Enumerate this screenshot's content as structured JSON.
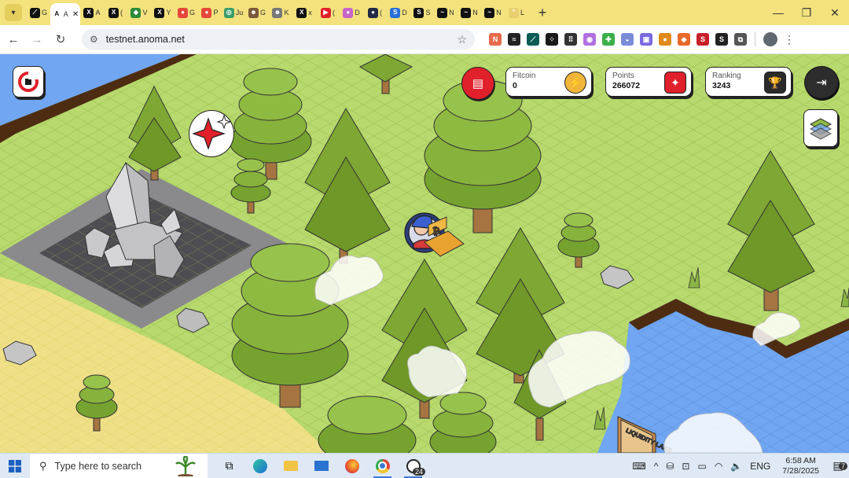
{
  "browser": {
    "tabs": [
      {
        "letter": "G",
        "fav": "#111111",
        "glyph": "⟋"
      },
      {
        "letter": "A",
        "fav": "#ffffff",
        "glyph": "A",
        "active": true
      },
      {
        "letter": "A",
        "fav": "#111111",
        "glyph": "X"
      },
      {
        "letter": "(",
        "fav": "#111111",
        "glyph": "X"
      },
      {
        "letter": "V",
        "fav": "#2c8a3a",
        "glyph": "◆"
      },
      {
        "letter": "Y",
        "fav": "#111111",
        "glyph": "X"
      },
      {
        "letter": "G",
        "fav": "#e4473a",
        "glyph": "●"
      },
      {
        "letter": "P",
        "fav": "#e4473a",
        "glyph": "●"
      },
      {
        "letter": "Ju",
        "fav": "#3a9d6a",
        "glyph": "◎"
      },
      {
        "letter": "G",
        "fav": "#7a5a3a",
        "glyph": "☻"
      },
      {
        "letter": "K",
        "fav": "#777777",
        "glyph": "☻"
      },
      {
        "letter": "x",
        "fav": "#111111",
        "glyph": "X"
      },
      {
        "letter": "(",
        "fav": "#e0202a",
        "glyph": "▶"
      },
      {
        "letter": "D",
        "fav": "#c864c8",
        "glyph": "●"
      },
      {
        "letter": "(",
        "fav": "#222a44",
        "glyph": "●"
      },
      {
        "letter": "D",
        "fav": "#2a6ed8",
        "glyph": "S"
      },
      {
        "letter": "S",
        "fav": "#111111",
        "glyph": "S"
      },
      {
        "letter": "N",
        "fav": "#111111",
        "glyph": "~"
      },
      {
        "letter": "N",
        "fav": "#111111",
        "glyph": "~"
      },
      {
        "letter": "N",
        "fav": "#111111",
        "glyph": "~"
      },
      {
        "letter": "L",
        "fav": "#e8d070",
        "glyph": "\""
      }
    ],
    "close_glyph": "✕",
    "new_tab_glyph": "+",
    "window_controls": {
      "minimize": "—",
      "restore": "❐",
      "close": "✕"
    },
    "url": "testnet.anoma.net",
    "nav": {
      "back": "←",
      "forward": "→",
      "reload": "↻"
    },
    "extensions": [
      {
        "glyph": "N",
        "color": "#e86a4a"
      },
      {
        "glyph": "≈",
        "color": "#222222"
      },
      {
        "glyph": "⟋",
        "color": "#0b5c55"
      },
      {
        "glyph": "⁘",
        "color": "#1a1a1a"
      },
      {
        "glyph": "⠿",
        "color": "#333333"
      },
      {
        "glyph": "◉",
        "color": "#b070e0"
      },
      {
        "glyph": "✚",
        "color": "#3bb04a"
      },
      {
        "glyph": "◒",
        "color": "#7a8cd8"
      },
      {
        "glyph": "▣",
        "color": "#7a6ae0"
      },
      {
        "glyph": "●",
        "color": "#e08a1a"
      },
      {
        "glyph": "◆",
        "color": "#e86a2a"
      },
      {
        "glyph": "S",
        "color": "#c8202a"
      },
      {
        "glyph": "S",
        "color": "#222222"
      },
      {
        "glyph": "⧉",
        "color": "#555555"
      }
    ]
  },
  "hud": {
    "fitcoin": {
      "label": "Fitcoin",
      "value": "0"
    },
    "points": {
      "label": "Points",
      "value": "266072"
    },
    "ranking": {
      "label": "Ranking",
      "value": "3243"
    }
  },
  "scene": {
    "sign_text": "LIQUIDITY LAKE"
  },
  "taskbar": {
    "search_placeholder": "Type here to search",
    "whatsapp_badge": "24",
    "language": "ENG",
    "time": "6:58 AM",
    "date": "7/28/2025",
    "notification_count": "7"
  }
}
